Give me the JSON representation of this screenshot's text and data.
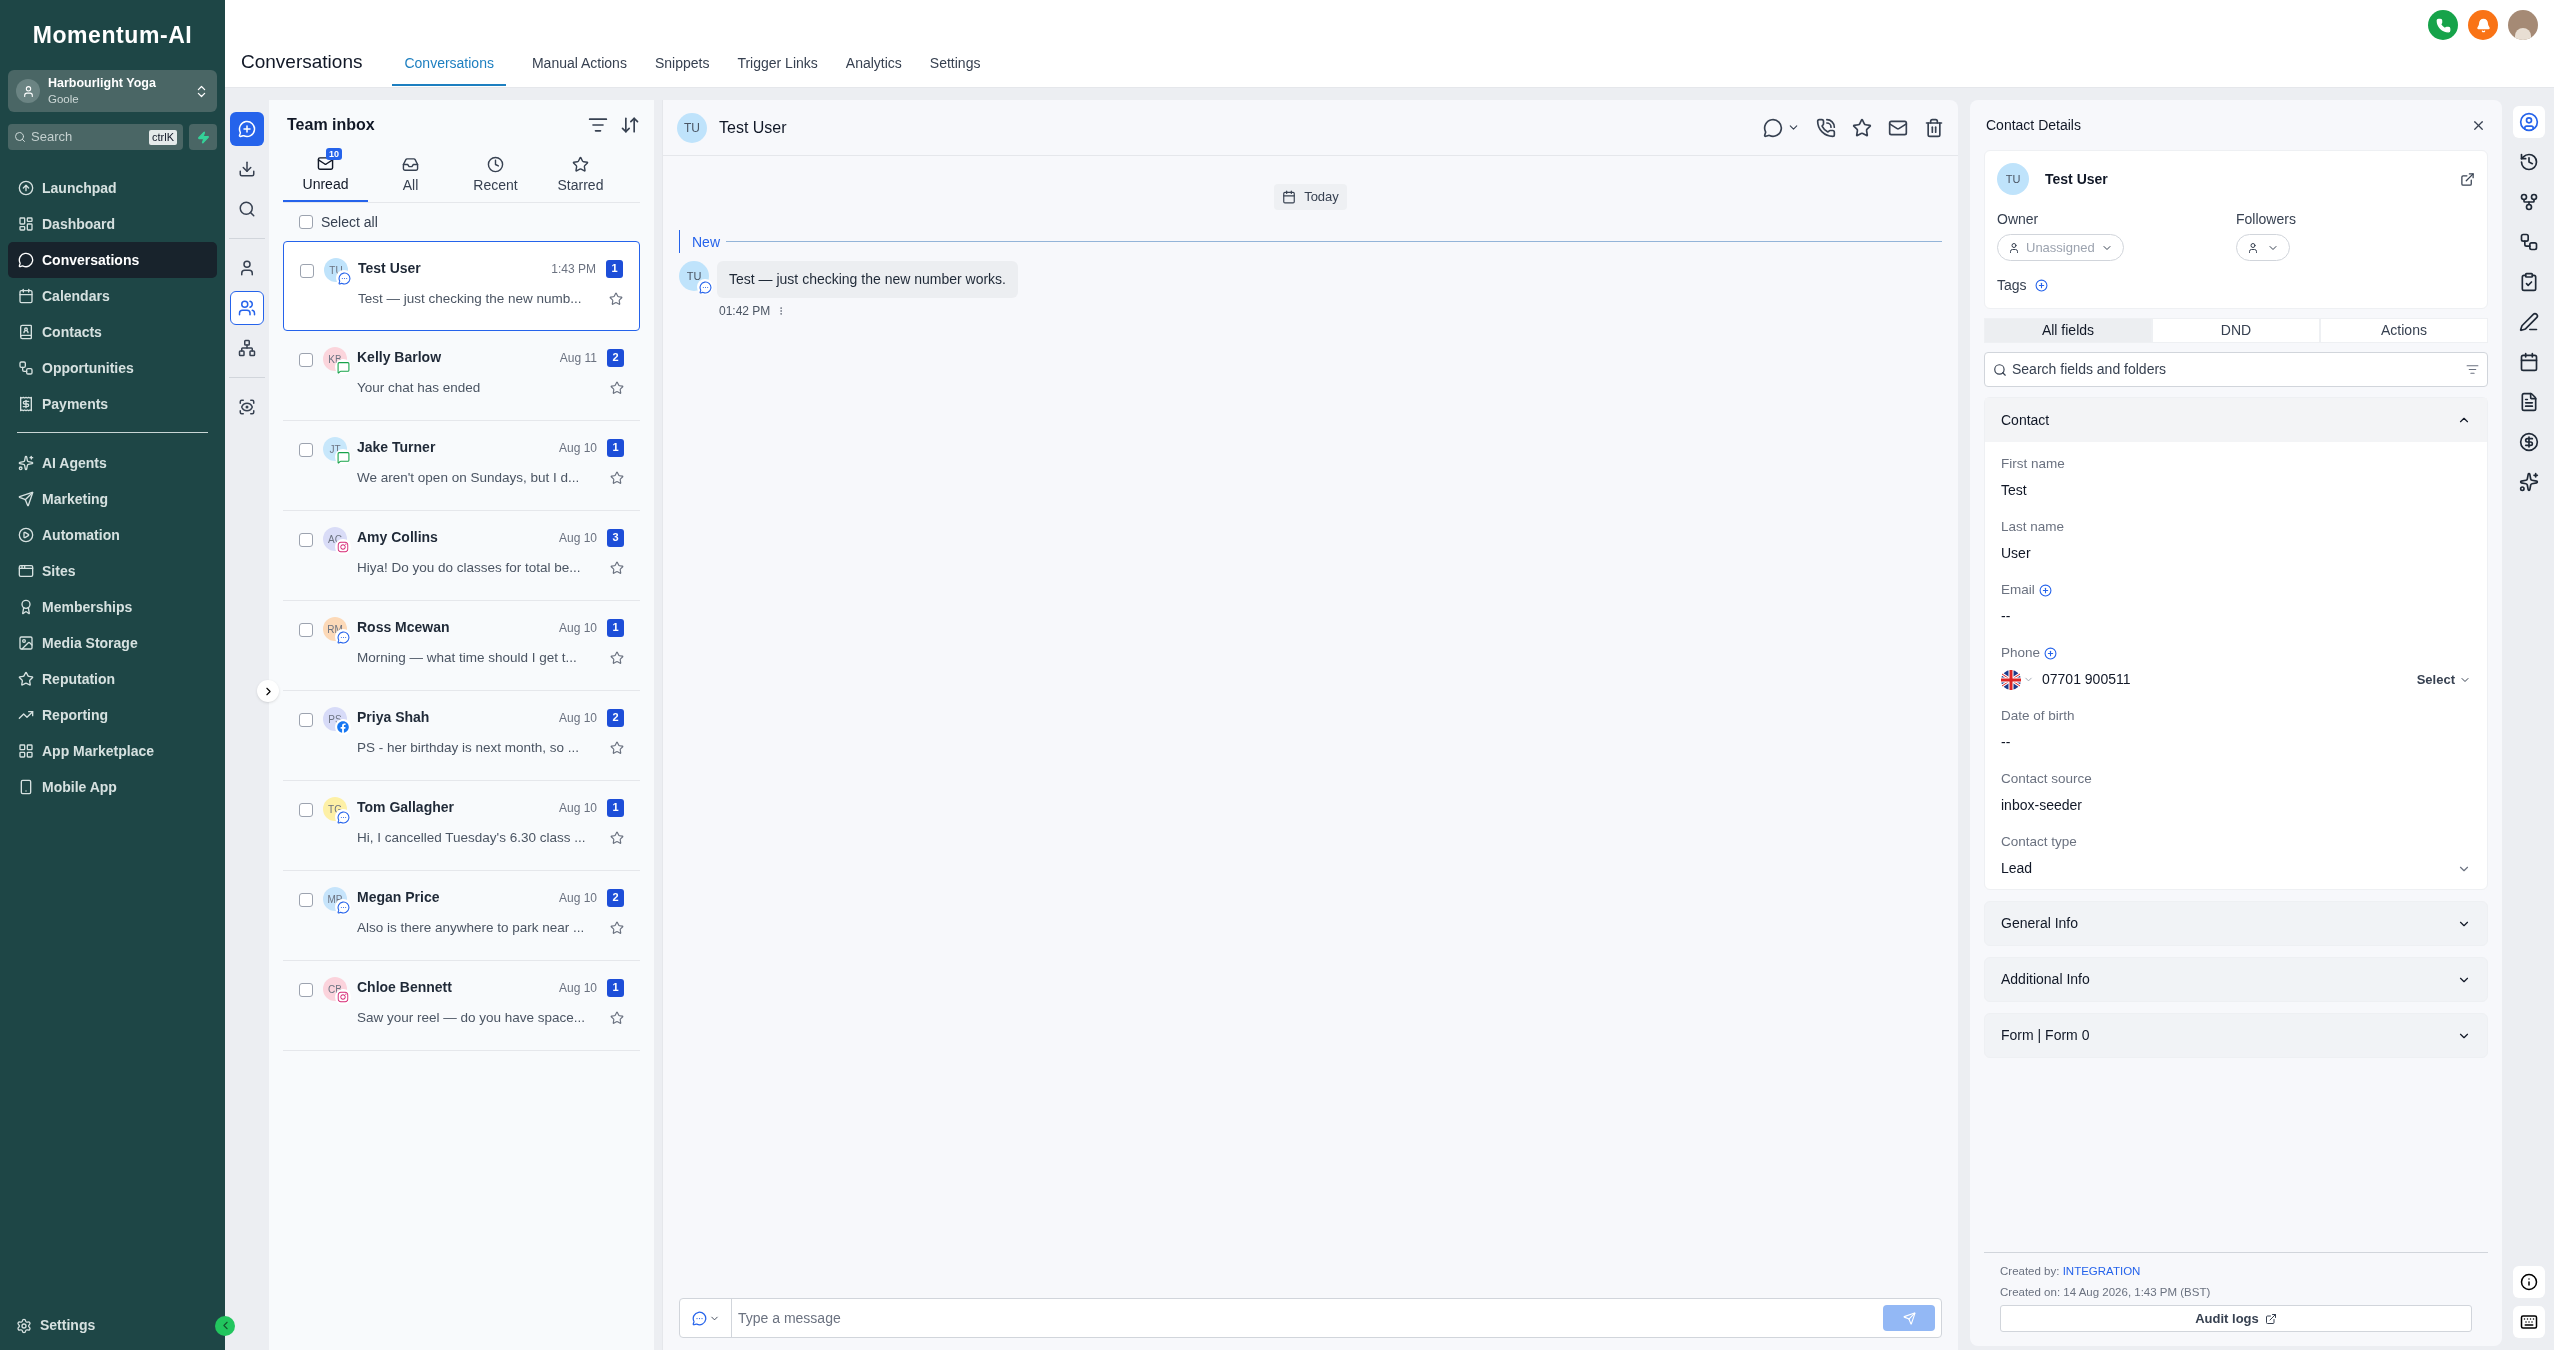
{
  "sidebar": {
    "logo": "Momentum-AI",
    "account": {
      "name": "Harbourlight Yoga",
      "location": "Goole"
    },
    "search": {
      "placeholder": "Search",
      "shortcut": "ctrlK"
    },
    "nav_groups": [
      [
        {
          "label": "Launchpad",
          "selected": false
        },
        {
          "label": "Dashboard",
          "selected": false
        },
        {
          "label": "Conversations",
          "selected": true
        },
        {
          "label": "Calendars",
          "selected": false
        },
        {
          "label": "Contacts",
          "selected": false
        },
        {
          "label": "Opportunities",
          "selected": false
        },
        {
          "label": "Payments",
          "selected": false
        }
      ],
      [
        {
          "label": "AI Agents",
          "selected": false
        },
        {
          "label": "Marketing",
          "selected": false
        },
        {
          "label": "Automation",
          "selected": false
        },
        {
          "label": "Sites",
          "selected": false
        },
        {
          "label": "Memberships",
          "selected": false
        },
        {
          "label": "Media Storage",
          "selected": false
        },
        {
          "label": "Reputation",
          "selected": false
        },
        {
          "label": "Reporting",
          "selected": false
        },
        {
          "label": "App Marketplace",
          "selected": false
        },
        {
          "label": "Mobile App",
          "selected": false
        }
      ]
    ],
    "settings": "Settings"
  },
  "header": {
    "title": "Conversations",
    "tabs": [
      {
        "label": "Conversations",
        "selected": true
      },
      {
        "label": "Manual Actions",
        "selected": false
      },
      {
        "label": "Snippets",
        "selected": false
      },
      {
        "label": "Trigger Links",
        "selected": false
      },
      {
        "label": "Analytics",
        "selected": false
      },
      {
        "label": "Settings",
        "selected": false
      }
    ]
  },
  "icon_rail": [
    {
      "selected": true
    },
    {
      "selected": false
    },
    {
      "selected": false
    },
    {
      "selected": false
    },
    {
      "selected": true
    },
    {
      "selected": false
    },
    {
      "selected": false
    }
  ],
  "inbox": {
    "title": "Team inbox",
    "tabs": [
      {
        "label": "Unread",
        "badge": "10",
        "selected": true
      },
      {
        "label": "All",
        "selected": false
      },
      {
        "label": "Recent",
        "selected": false
      },
      {
        "label": "Starred",
        "selected": false
      }
    ],
    "select_all": {
      "label": "Select all",
      "checked": false
    },
    "conversations": [
      {
        "initials": "TU",
        "name": "Test User",
        "time": "1:43 PM",
        "count": "1",
        "preview": "Test — just checking the new numb...",
        "kind": "chat",
        "color": "#bfe3fb",
        "selected": true
      },
      {
        "initials": "KB",
        "name": "Kelly Barlow",
        "time": "Aug 11",
        "count": "2",
        "preview": "Your chat has ended",
        "kind": "sms",
        "color": "#fbd5dc",
        "selected": false
      },
      {
        "initials": "JT",
        "name": "Jake Turner",
        "time": "Aug 10",
        "count": "1",
        "preview": "We aren't open on Sundays, but I d...",
        "kind": "sms",
        "color": "#c7e7fb",
        "selected": false
      },
      {
        "initials": "AC",
        "name": "Amy Collins",
        "time": "Aug 10",
        "count": "3",
        "preview": "Hiya! Do you do classes for total be...",
        "kind": "instagram",
        "color": "#d9dcf7",
        "selected": false
      },
      {
        "initials": "RM",
        "name": "Ross Mcewan",
        "time": "Aug 10",
        "count": "1",
        "preview": "Morning — what time should I get t...",
        "kind": "chat",
        "color": "#fcd9b8",
        "selected": false
      },
      {
        "initials": "PS",
        "name": "Priya Shah",
        "time": "Aug 10",
        "count": "2",
        "preview": "PS - her birthday is next month, so ...",
        "kind": "facebook",
        "color": "#d7dbf8",
        "selected": false
      },
      {
        "initials": "TG",
        "name": "Tom Gallagher",
        "time": "Aug 10",
        "count": "1",
        "preview": "Hi, I cancelled Tuesday's 6.30 class ...",
        "kind": "chat",
        "color": "#fdf0a6",
        "selected": false
      },
      {
        "initials": "MP",
        "name": "Megan Price",
        "time": "Aug 10",
        "count": "2",
        "preview": "Also is there anywhere to park near ...",
        "kind": "chat",
        "color": "#c6e4fb",
        "selected": false
      },
      {
        "initials": "CB",
        "name": "Chloe Bennett",
        "time": "Aug 10",
        "count": "1",
        "preview": "Saw your reel — do you have space...",
        "kind": "instagram",
        "color": "#fbd3dc",
        "selected": false
      }
    ]
  },
  "chat": {
    "initials": "TU",
    "name": "Test User",
    "date": "Today",
    "divider": "New",
    "message": {
      "initials": "TU",
      "text": "Test — just checking the new number works.",
      "time": "01:42 PM"
    },
    "composer": {
      "placeholder": "Type a message"
    }
  },
  "contact": {
    "title": "Contact Details",
    "initials": "TU",
    "name": "Test User",
    "owner_label": "Owner",
    "owner": "Unassigned",
    "followers_label": "Followers",
    "tags_label": "Tags",
    "tabs": [
      {
        "label": "All fields",
        "selected": true
      },
      {
        "label": "DND",
        "selected": false
      },
      {
        "label": "Actions",
        "selected": false
      }
    ],
    "search": {
      "placeholder": "Search fields and folders"
    },
    "section": {
      "title": "Contact",
      "expanded": true
    },
    "fields": [
      {
        "label": "First name",
        "value": "Test",
        "kind": "text",
        "addable": false
      },
      {
        "label": "Last name",
        "value": "User",
        "kind": "text",
        "addable": false
      },
      {
        "label": "Email",
        "value": "--",
        "kind": "text",
        "addable": true
      },
      {
        "label": "Phone",
        "value": "07701 900511",
        "select": "Select",
        "kind": "phone",
        "addable": true
      },
      {
        "label": "Date of birth",
        "value": "--",
        "kind": "text",
        "addable": false
      },
      {
        "label": "Contact source",
        "value": "inbox-seeder",
        "kind": "text",
        "addable": false
      },
      {
        "label": "Contact type",
        "value": "Lead",
        "kind": "select",
        "addable": false
      }
    ],
    "collapsed_sections": [
      "General Info",
      "Additional Info",
      "Form | Form 0"
    ],
    "created_by_label": "Created by:",
    "created_by": "INTEGRATION",
    "created_on": "Created on: 14 Aug 2026, 1:43 PM (BST)",
    "audit_logs": "Audit logs"
  },
  "right_rail": [
    {
      "selected": true
    },
    {
      "selected": false
    },
    {
      "selected": false
    },
    {
      "selected": false
    },
    {
      "selected": false
    },
    {
      "selected": false
    },
    {
      "selected": false
    },
    {
      "selected": false
    },
    {
      "selected": false
    },
    {
      "selected": false
    }
  ]
}
